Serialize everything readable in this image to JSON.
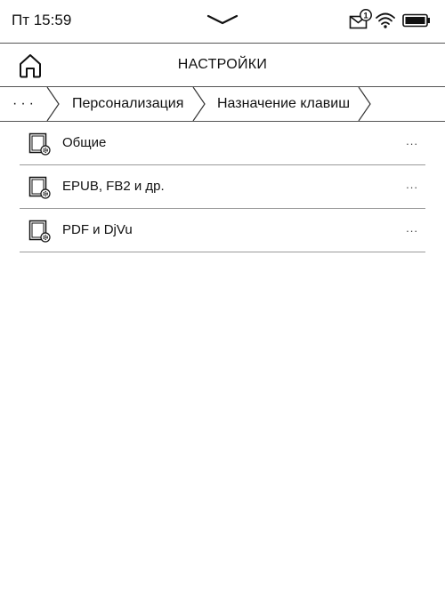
{
  "status_bar": {
    "time": "Пт 15:59",
    "notification_count": "1",
    "icons": [
      "chevron-down-icon",
      "mail-notification-icon",
      "wifi-icon",
      "battery-icon"
    ]
  },
  "header": {
    "title": "НАСТРОЙКИ",
    "home_icon": "home-icon"
  },
  "breadcrumb": {
    "more": "···",
    "items": [
      "Персонализация",
      "Назначение клавиш"
    ]
  },
  "list": {
    "items": [
      {
        "label": "Общие",
        "more": "...",
        "icon": "settings-document-icon"
      },
      {
        "label": "EPUB, FB2 и др.",
        "more": "...",
        "icon": "settings-document-icon"
      },
      {
        "label": "PDF и DjVu",
        "more": "...",
        "icon": "settings-document-icon"
      }
    ]
  }
}
